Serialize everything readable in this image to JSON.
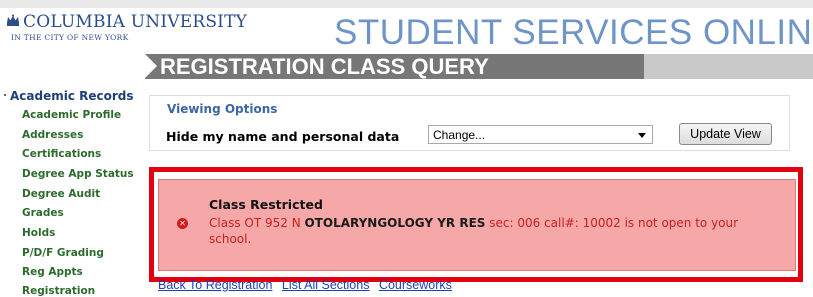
{
  "header": {
    "university_name": "COLUMBIA UNIVERSITY",
    "university_tagline": "IN THE CITY OF NEW YORK",
    "site_title": "STUDENT SERVICES ONLINE",
    "page_title": "REGISTRATION CLASS QUERY"
  },
  "sidebar": {
    "section_label": "Academic Records",
    "items": [
      {
        "label": "Academic Profile"
      },
      {
        "label": "Addresses"
      },
      {
        "label": "Certifications"
      },
      {
        "label": "Degree App Status"
      },
      {
        "label": "Degree Audit"
      },
      {
        "label": "Grades"
      },
      {
        "label": "Holds"
      },
      {
        "label": "P/D/F Grading"
      },
      {
        "label": "Reg Appts"
      },
      {
        "label": "Registration"
      }
    ]
  },
  "viewing_options": {
    "heading": "Viewing Options",
    "label": "Hide my name and personal data",
    "select_value": "Change...",
    "update_button": "Update View"
  },
  "alert": {
    "title": "Class Restricted",
    "msg_prefix": "Class OT 952 N ",
    "msg_course": "OTOLARYNGOLOGY YR RES",
    "msg_suffix": " sec: 006 call#: 10002 is not open to your school.",
    "icon": "error-circle-x-icon",
    "frame_color": "#e3000f",
    "bg_color": "#f6a8a8"
  },
  "links": {
    "back": "Back To Registration",
    "list_all": "List All Sections",
    "courseworks": "Courseworks"
  },
  "colors": {
    "site_title": "#6f95c7",
    "title_bar": "#777777",
    "sidebar_link": "#2d6b2d",
    "link": "#1f3fb8"
  }
}
